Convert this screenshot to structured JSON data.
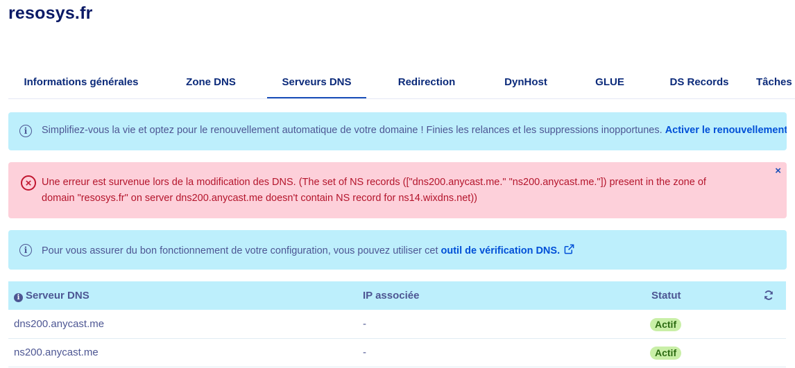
{
  "page": {
    "title": "resosys.fr"
  },
  "tabs": [
    {
      "label": "Informations générales"
    },
    {
      "label": "Zone DNS"
    },
    {
      "label": "Serveurs DNS",
      "active": true
    },
    {
      "label": "Redirection"
    },
    {
      "label": "DynHost"
    },
    {
      "label": "GLUE"
    },
    {
      "label": "DS Records"
    },
    {
      "label": "Tâches"
    }
  ],
  "banners": {
    "renewal": {
      "text": "Simplifiez-vous la vie et optez pour le renouvellement automatique de votre domaine ! Finies les relances et les suppressions inopportunes.",
      "link": "Activer le renouvellement automatique"
    },
    "error": {
      "line1": "Une erreur est survenue lors de la modification des DNS. (The set of NS records ([\"dns200.anycast.me.\" \"ns200.anycast.me.\"]) present in the zone of",
      "line2": "domain \"resosys.fr\" on server dns200.anycast.me doesn't contain NS record for ns14.wixdns.net))",
      "close": "×"
    },
    "check": {
      "text": "Pour vous assurer du bon fonctionnement de votre configuration, vous pouvez utiliser cet",
      "link": "outil de vérification DNS."
    }
  },
  "table": {
    "headers": {
      "server": "Serveur DNS",
      "ip": "IP associée",
      "status": "Statut"
    },
    "rows": [
      {
        "server": "dns200.anycast.me",
        "ip": "-",
        "status": "Actif"
      },
      {
        "server": "ns200.anycast.me",
        "ip": "-",
        "status": "Actif"
      }
    ]
  },
  "colors": {
    "info_bg": "#bdeffc",
    "error_bg": "#fdd0da",
    "link": "#0050d7",
    "badge_bg": "#c9efa7"
  }
}
